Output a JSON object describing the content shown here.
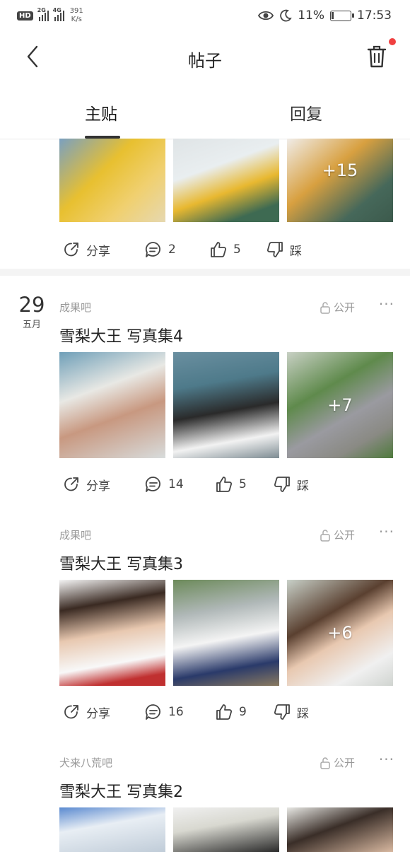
{
  "status": {
    "hd": "HD",
    "sim1": "2G",
    "sim2": "4G",
    "speed_value": "391",
    "speed_unit": "K/s",
    "battery": "11%",
    "battery_level": 0.11,
    "time": "17:53"
  },
  "nav": {
    "title": "帖子"
  },
  "tabs": [
    {
      "label": "主贴"
    },
    {
      "label": "回复"
    }
  ],
  "colors": {
    "badge": "#f04040",
    "text": "#333333",
    "muted": "#999999"
  },
  "posts": [
    {
      "images_more": "+15",
      "share": "分享",
      "comments": "2",
      "likes": "5",
      "dislike": "踩"
    },
    {
      "day": "29",
      "month": "五月",
      "bar": "成果吧",
      "visibility": "公开",
      "title": "雪梨大王 写真集4",
      "images_more": "+7",
      "share": "分享",
      "comments": "14",
      "likes": "5",
      "dislike": "踩"
    },
    {
      "bar": "成果吧",
      "visibility": "公开",
      "title": "雪梨大王 写真集3",
      "images_more": "+6",
      "share": "分享",
      "comments": "16",
      "likes": "9",
      "dislike": "踩"
    },
    {
      "bar": "犬来八荒吧",
      "visibility": "公开",
      "title": "雪梨大王 写真集2"
    }
  ]
}
